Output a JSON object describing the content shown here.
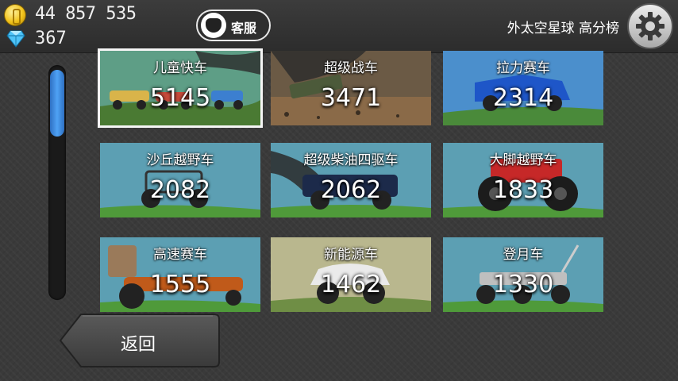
{
  "header": {
    "coins": "44 857 535",
    "gems": "367",
    "support_label": "客服",
    "board_title": "外太空星球 高分榜"
  },
  "icons": {
    "coin": "coin-icon",
    "gem": "gem-icon",
    "support": "support-icon",
    "settings": "gear-icon"
  },
  "vehicles": [
    {
      "name": "儿童快车",
      "score": "5145",
      "selected": true
    },
    {
      "name": "超级战车",
      "score": "3471"
    },
    {
      "name": "拉力赛车",
      "score": "2314"
    },
    {
      "name": "沙丘越野车",
      "score": "2082"
    },
    {
      "name": "超级柴油四驱车",
      "score": "2062"
    },
    {
      "name": "大脚越野车",
      "score": "1833"
    },
    {
      "name": "高速赛车",
      "score": "1555"
    },
    {
      "name": "新能源车",
      "score": "1462"
    },
    {
      "name": "登月车",
      "score": "1330"
    }
  ],
  "footer": {
    "back_label": "返回"
  },
  "colors": {
    "accent": "#3f8ee0",
    "sky": "#6fb6cb",
    "grass": "#4c8a3a"
  }
}
